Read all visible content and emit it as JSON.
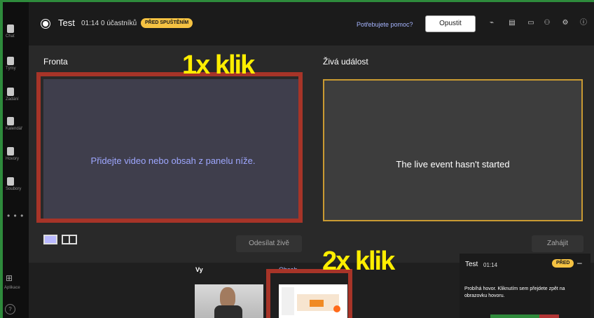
{
  "rail": {
    "items": [
      {
        "label": "Chat",
        "icon": "chat-icon"
      },
      {
        "label": "Týmy",
        "icon": "teams-icon"
      },
      {
        "label": "Zadání",
        "icon": "assignments-icon"
      },
      {
        "label": "Kalendář",
        "icon": "calendar-icon"
      },
      {
        "label": "Hovory",
        "icon": "calls-icon"
      },
      {
        "label": "Soubory",
        "icon": "files-icon"
      }
    ],
    "more": "• • •",
    "apps_label": "Aplikace",
    "help_label": "?"
  },
  "topbar": {
    "title": "Test",
    "time": "01:14",
    "participants": "0 účastníků",
    "badge": "PŘED SPUŠTĚNÍM",
    "help_link": "Potřebujete pomoc?",
    "leave": "Opustit",
    "icons": [
      "health-icon",
      "notes-icon",
      "chat-icon",
      "participants-icon",
      "settings-icon",
      "info-icon"
    ]
  },
  "queue": {
    "label": "Fronta",
    "placeholder": "Přidejte video nebo obsah z panelu níže.",
    "send_button": "Odesílat živě"
  },
  "live": {
    "label": "Živá událost",
    "status": "The live event hasn't started",
    "start_button": "Zahájit"
  },
  "annotations": {
    "first": "1x klik",
    "second": "2x klik",
    "color": "#ffee00",
    "outline_color": "#a73428"
  },
  "sources": {
    "you_label": "Vy",
    "content_label": "Obsah"
  },
  "mini_window": {
    "title": "Test",
    "time": "01:14",
    "badge": "PŘED",
    "minimize": "–",
    "message": "Probíhá hovor. Kliknutím sem přejdete zpět na obrazovku hovoru."
  },
  "colors": {
    "accent": "#9ea7ff",
    "badge": "#f5c242",
    "live_border": "#c99a32"
  }
}
